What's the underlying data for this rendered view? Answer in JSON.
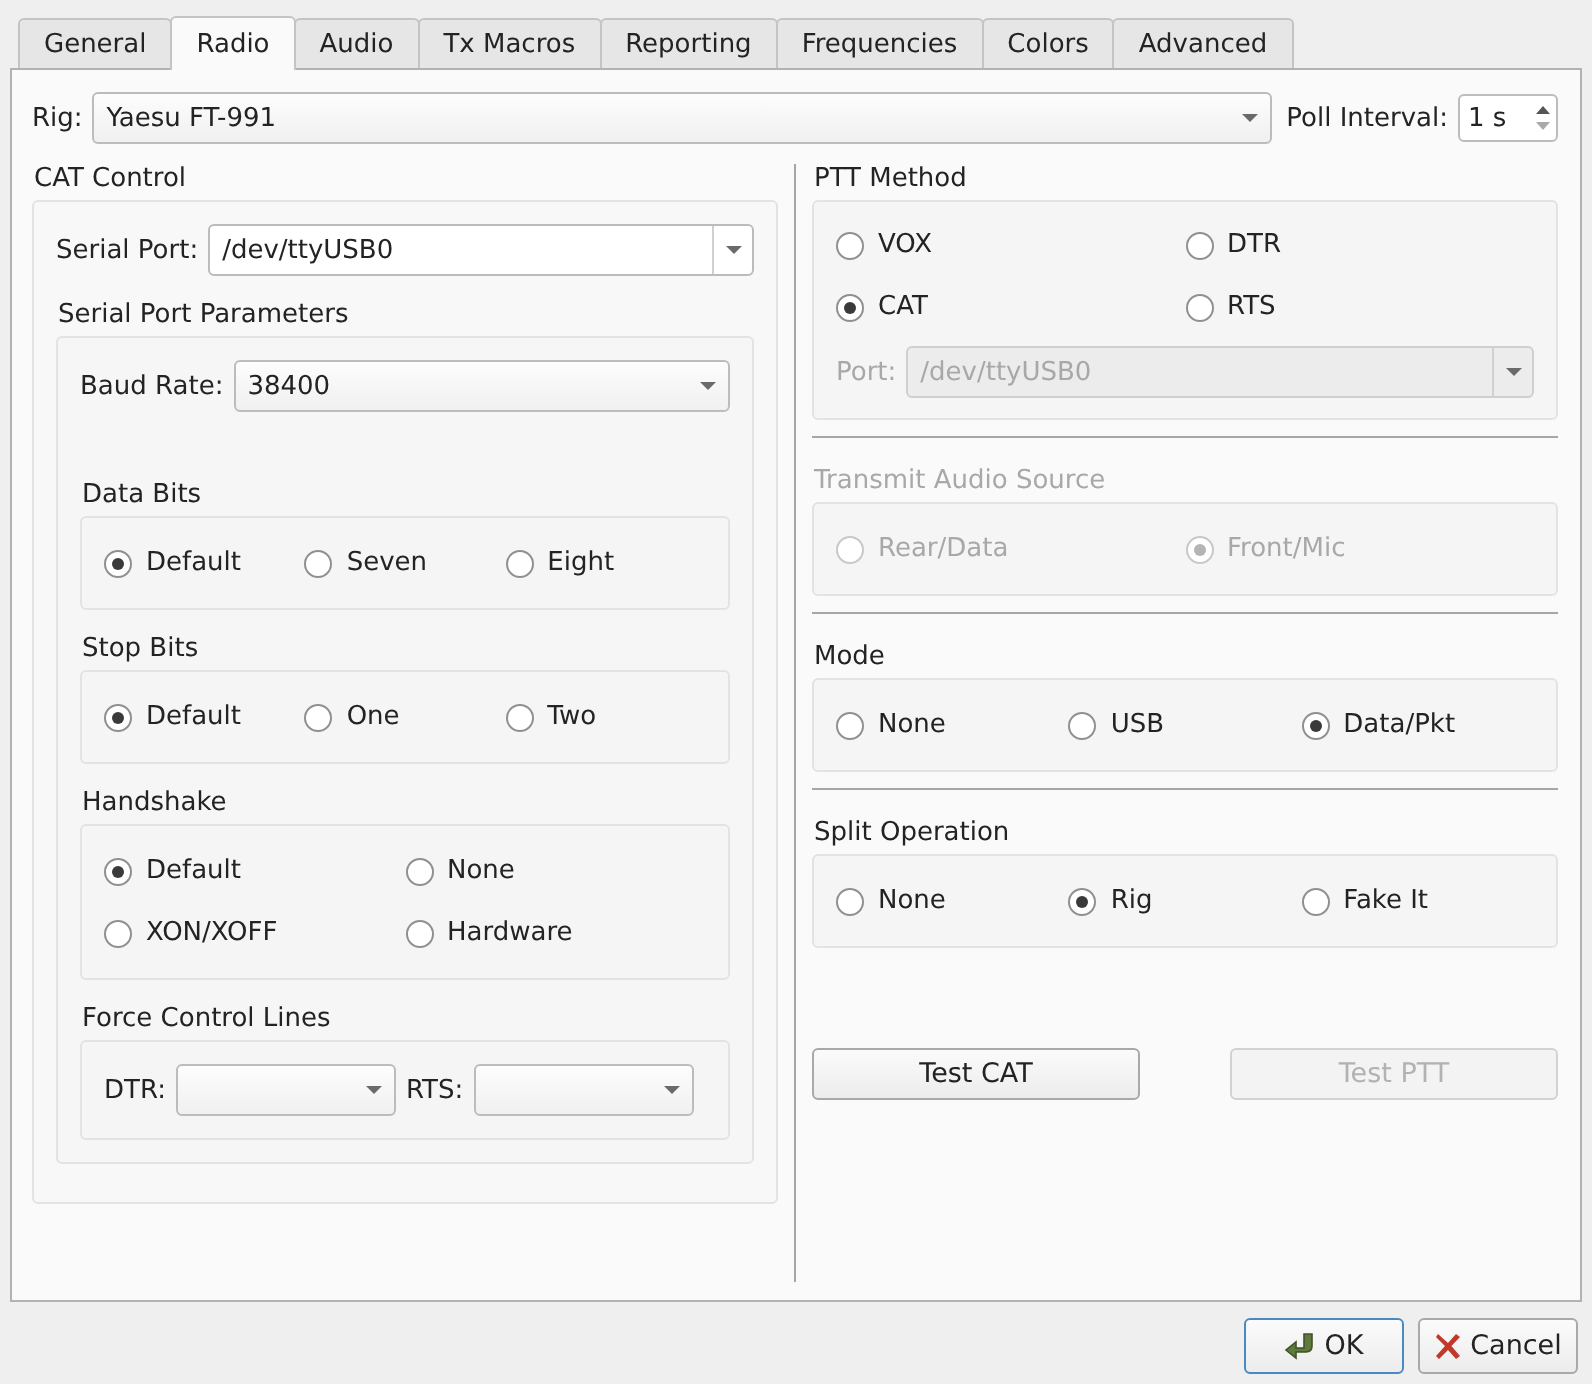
{
  "tabs": [
    {
      "label": "General",
      "selected": false
    },
    {
      "label": "Radio",
      "selected": true
    },
    {
      "label": "Audio",
      "selected": false
    },
    {
      "label": "Tx Macros",
      "selected": false
    },
    {
      "label": "Reporting",
      "selected": false
    },
    {
      "label": "Frequencies",
      "selected": false
    },
    {
      "label": "Colors",
      "selected": false
    },
    {
      "label": "Advanced",
      "selected": false
    }
  ],
  "rig": {
    "label": "Rig:",
    "value": "Yaesu FT-991"
  },
  "poll_interval": {
    "label": "Poll Interval:",
    "value": "1 s"
  },
  "cat_control": {
    "title": "CAT Control",
    "serial_port": {
      "label": "Serial Port:",
      "value": "/dev/ttyUSB0"
    },
    "serial_port_parameters": {
      "title": "Serial Port Parameters",
      "baud_rate": {
        "label": "Baud Rate:",
        "value": "38400"
      },
      "groups": [
        {
          "title": "Data Bits",
          "rows": [
            [
              {
                "label": "Default",
                "selected": true
              },
              {
                "label": "Seven",
                "selected": false
              },
              {
                "label": "Eight",
                "selected": false
              }
            ]
          ]
        },
        {
          "title": "Stop Bits",
          "rows": [
            [
              {
                "label": "Default",
                "selected": true
              },
              {
                "label": "One",
                "selected": false
              },
              {
                "label": "Two",
                "selected": false
              }
            ]
          ]
        },
        {
          "title": "Handshake",
          "rows": [
            [
              {
                "label": "Default",
                "selected": true
              },
              {
                "label": "None",
                "selected": false
              }
            ],
            [
              {
                "label": "XON/XOFF",
                "selected": false
              },
              {
                "label": "Hardware",
                "selected": false
              }
            ]
          ]
        }
      ],
      "force_control_lines": {
        "title": "Force Control Lines",
        "fields": [
          {
            "label": "DTR:"
          },
          {
            "label": "RTS:"
          }
        ]
      }
    }
  },
  "ptt_method": {
    "title": "PTT Method",
    "rows": [
      [
        {
          "label": "VOX",
          "selected": false
        },
        {
          "label": "DTR",
          "selected": false
        }
      ],
      [
        {
          "label": "CAT",
          "selected": true
        },
        {
          "label": "RTS",
          "selected": false
        }
      ]
    ],
    "port": {
      "label": "Port:",
      "value": "/dev/ttyUSB0",
      "disabled": true
    }
  },
  "sections": [
    {
      "title": "Transmit Audio Source",
      "disabled": true,
      "rows": [
        [
          {
            "label": "Rear/Data",
            "selected": false
          },
          {
            "label": "Front/Mic",
            "selected": true
          }
        ]
      ]
    },
    {
      "title": "Mode",
      "disabled": false,
      "rows": [
        [
          {
            "label": "None",
            "selected": false
          },
          {
            "label": "USB",
            "selected": false
          },
          {
            "label": "Data/Pkt",
            "selected": true
          }
        ]
      ]
    },
    {
      "title": "Split Operation",
      "disabled": false,
      "rows": [
        [
          {
            "label": "None",
            "selected": false
          },
          {
            "label": "Rig",
            "selected": true
          },
          {
            "label": "Fake It",
            "selected": false
          }
        ]
      ]
    }
  ],
  "test_buttons": [
    {
      "label": "Test CAT",
      "disabled": false
    },
    {
      "label": "Test PTT",
      "disabled": true
    }
  ],
  "dialog_buttons": [
    {
      "label": "OK",
      "kind": "ok"
    },
    {
      "label": "Cancel",
      "kind": "cancel"
    }
  ]
}
